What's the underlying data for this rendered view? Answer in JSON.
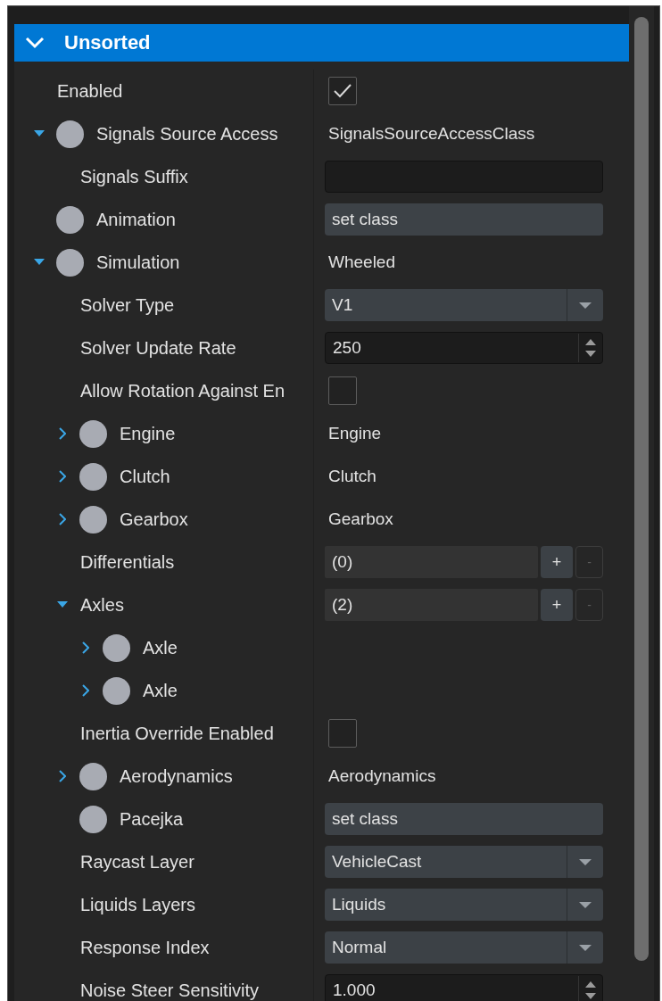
{
  "section": {
    "title": "Unsorted",
    "expanded": true
  },
  "rows": [
    {
      "label": "Enabled",
      "object": false,
      "value": {
        "kind": "checkbox",
        "checked": true
      }
    },
    {
      "label": "Signals Source Access",
      "object": true,
      "expanded": true,
      "value": {
        "kind": "text",
        "text": "SignalsSourceAccessClass"
      },
      "children": [
        {
          "label": "Signals Suffix",
          "object": false,
          "value": {
            "kind": "field"
          }
        }
      ]
    },
    {
      "label": "Animation",
      "object": true,
      "value": {
        "kind": "class",
        "text": "set class"
      }
    },
    {
      "label": "Simulation",
      "object": true,
      "expanded": true,
      "value": {
        "kind": "text",
        "text": "Wheeled"
      },
      "children": [
        {
          "label": "Solver Type",
          "object": false,
          "value": {
            "kind": "dropdown",
            "text": "V1"
          }
        },
        {
          "label": "Solver Update Rate",
          "object": false,
          "value": {
            "kind": "spin",
            "text": "250"
          }
        },
        {
          "label": "Allow Rotation Against En",
          "object": false,
          "value": {
            "kind": "checkbox",
            "checked": false
          }
        },
        {
          "label": "Engine",
          "object": true,
          "expanded": false,
          "value": {
            "kind": "text",
            "text": "Engine"
          }
        },
        {
          "label": "Clutch",
          "object": true,
          "expanded": false,
          "value": {
            "kind": "text",
            "text": "Clutch"
          }
        },
        {
          "label": "Gearbox",
          "object": true,
          "expanded": false,
          "value": {
            "kind": "text",
            "text": "Gearbox"
          }
        },
        {
          "label": "Differentials",
          "object": false,
          "value": {
            "kind": "array",
            "text": "(0)",
            "add": "+",
            "remove": "-",
            "remove_disabled": true
          }
        },
        {
          "label": "Axles",
          "object": false,
          "expanded": true,
          "value": {
            "kind": "array",
            "text": "(2)",
            "add": "+",
            "remove": "-",
            "remove_disabled": true
          },
          "children": [
            {
              "label": "Axle",
              "object": true,
              "expanded": false
            },
            {
              "label": "Axle",
              "object": true,
              "expanded": false
            }
          ]
        },
        {
          "label": "Inertia Override Enabled",
          "object": false,
          "value": {
            "kind": "checkbox",
            "checked": false
          }
        },
        {
          "label": "Aerodynamics",
          "object": true,
          "expanded": false,
          "value": {
            "kind": "text",
            "text": "Aerodynamics"
          }
        },
        {
          "label": "Pacejka",
          "object": true,
          "value": {
            "kind": "class",
            "text": "set class"
          }
        },
        {
          "label": "Raycast Layer",
          "object": false,
          "value": {
            "kind": "dropdown",
            "text": "VehicleCast"
          }
        },
        {
          "label": "Liquids Layers",
          "object": false,
          "value": {
            "kind": "dropdown",
            "text": "Liquids"
          }
        },
        {
          "label": "Response Index",
          "object": false,
          "value": {
            "kind": "dropdown",
            "text": "Normal"
          }
        },
        {
          "label": "Noise Steer Sensitivity",
          "object": false,
          "value": {
            "kind": "spin",
            "text": "1.000"
          }
        }
      ]
    }
  ]
}
